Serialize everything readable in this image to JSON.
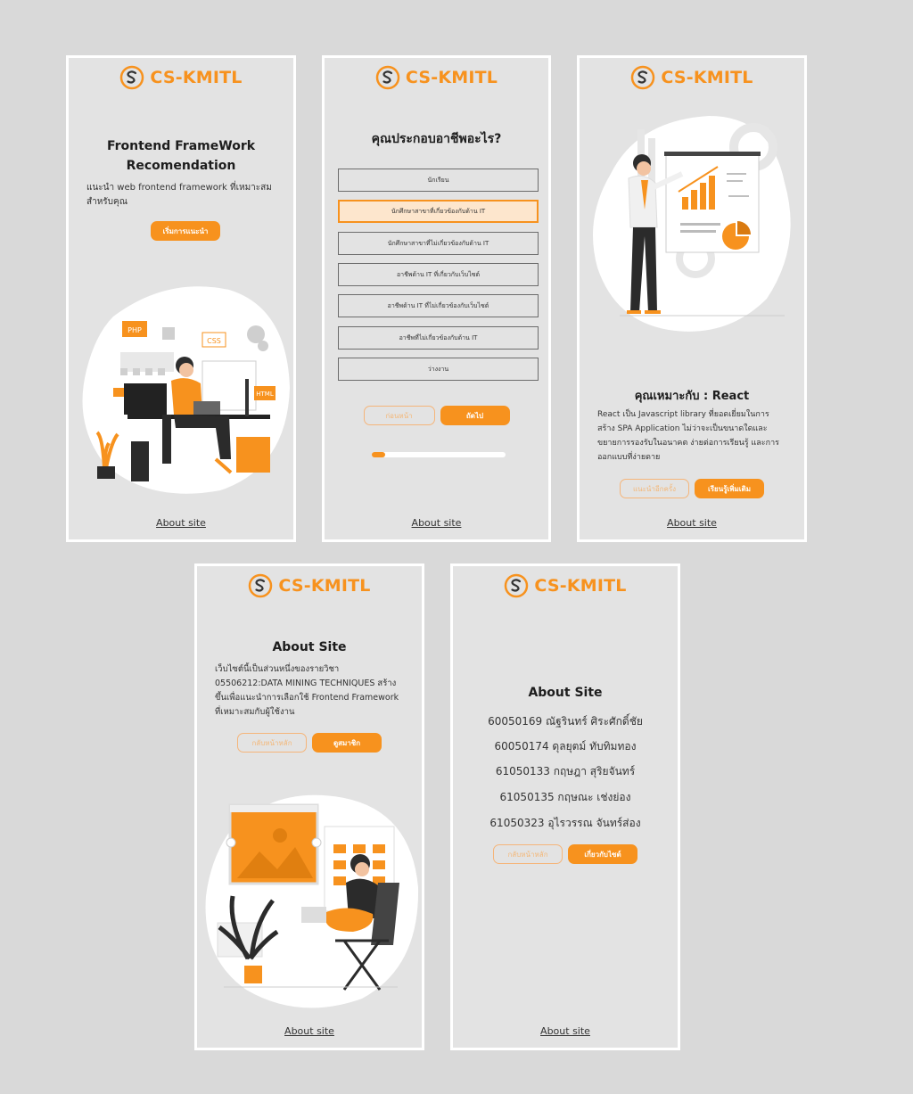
{
  "brand": {
    "name": "CS-KMITL",
    "accent": "#f7921e"
  },
  "footer_link": "About site",
  "screen_home": {
    "title_line1": "Frontend FrameWork",
    "title_line2": "Recomendation",
    "description": "แนะนำ web frontend framework ที่เหมาะสมสำหรับคุณ",
    "start_button": "เริ่มการแนะนำ",
    "illustration": {
      "tags": [
        "PHP",
        "CSS",
        "HTML"
      ]
    }
  },
  "screen_question": {
    "question": "คุณประกอบอาชีพอะไร?",
    "options": [
      {
        "label": "นักเรียน"
      },
      {
        "label": "นักศึกษาสาขาที่เกี่ยวข้องกับด้าน IT",
        "selected": true
      },
      {
        "label": "นักศึกษาสาขาที่ไม่เกี่ยวข้องกับด้าน IT"
      },
      {
        "label": "อาชีพด้าน IT ที่เกี่ยวกับเว็บไซต์"
      },
      {
        "label": "อาชีพด้าน IT ที่ไม่เกี่ยวข้องกับเว็บไซต์"
      },
      {
        "label": "อาชีพที่ไม่เกี่ยวข้องกับด้าน IT"
      },
      {
        "label": "ว่างงาน"
      }
    ],
    "back_button": "ก่อนหน้า",
    "next_button": "ถัดไป",
    "progress": 0.1
  },
  "screen_result": {
    "title": "คุณเหมาะกับ : React",
    "description": "React เป็น Javascript library ที่ยอดเยี่ยมในการสร้าง SPA Application ไม่ว่าจะเป็นขนาดใดและขยายการรองรับในอนาคต ง่ายต่อการเรียนรู้ และการออกแบบที่ง่ายดาย",
    "retry_button": "แนะนำอีกครั้ง",
    "learn_button": "เรียนรู้เพิ่มเติม"
  },
  "screen_about": {
    "title": "About Site",
    "description": "เว็บไซต์นี้เป็นส่วนหนึ่งของรายวิชา 05506212:DATA MINING TECHNIQUES สร้างขึ้นเพื่อแนะนำการเลือกใช้ Frontend Framework ที่เหมาะสมกับผู้ใช้งาน",
    "home_button": "กลับหน้าหลัก",
    "members_button": "ดูสมาชิก"
  },
  "screen_members": {
    "title": "About Site",
    "members": [
      "60050169 ณัฐรินทร์ ศิระศักดิ์ชัย",
      "60050174 ดุลยุตม์ ทับทิมทอง",
      "61050133 กฤษฎา สุริยจันทร์",
      "61050135 กฤษณะ เช่งย่อง",
      "61050323 อุไรวรรณ จันทร์ส่อง"
    ],
    "home_button": "กลับหน้าหลัก",
    "about_button": "เกี่ยวกับไซต์"
  }
}
